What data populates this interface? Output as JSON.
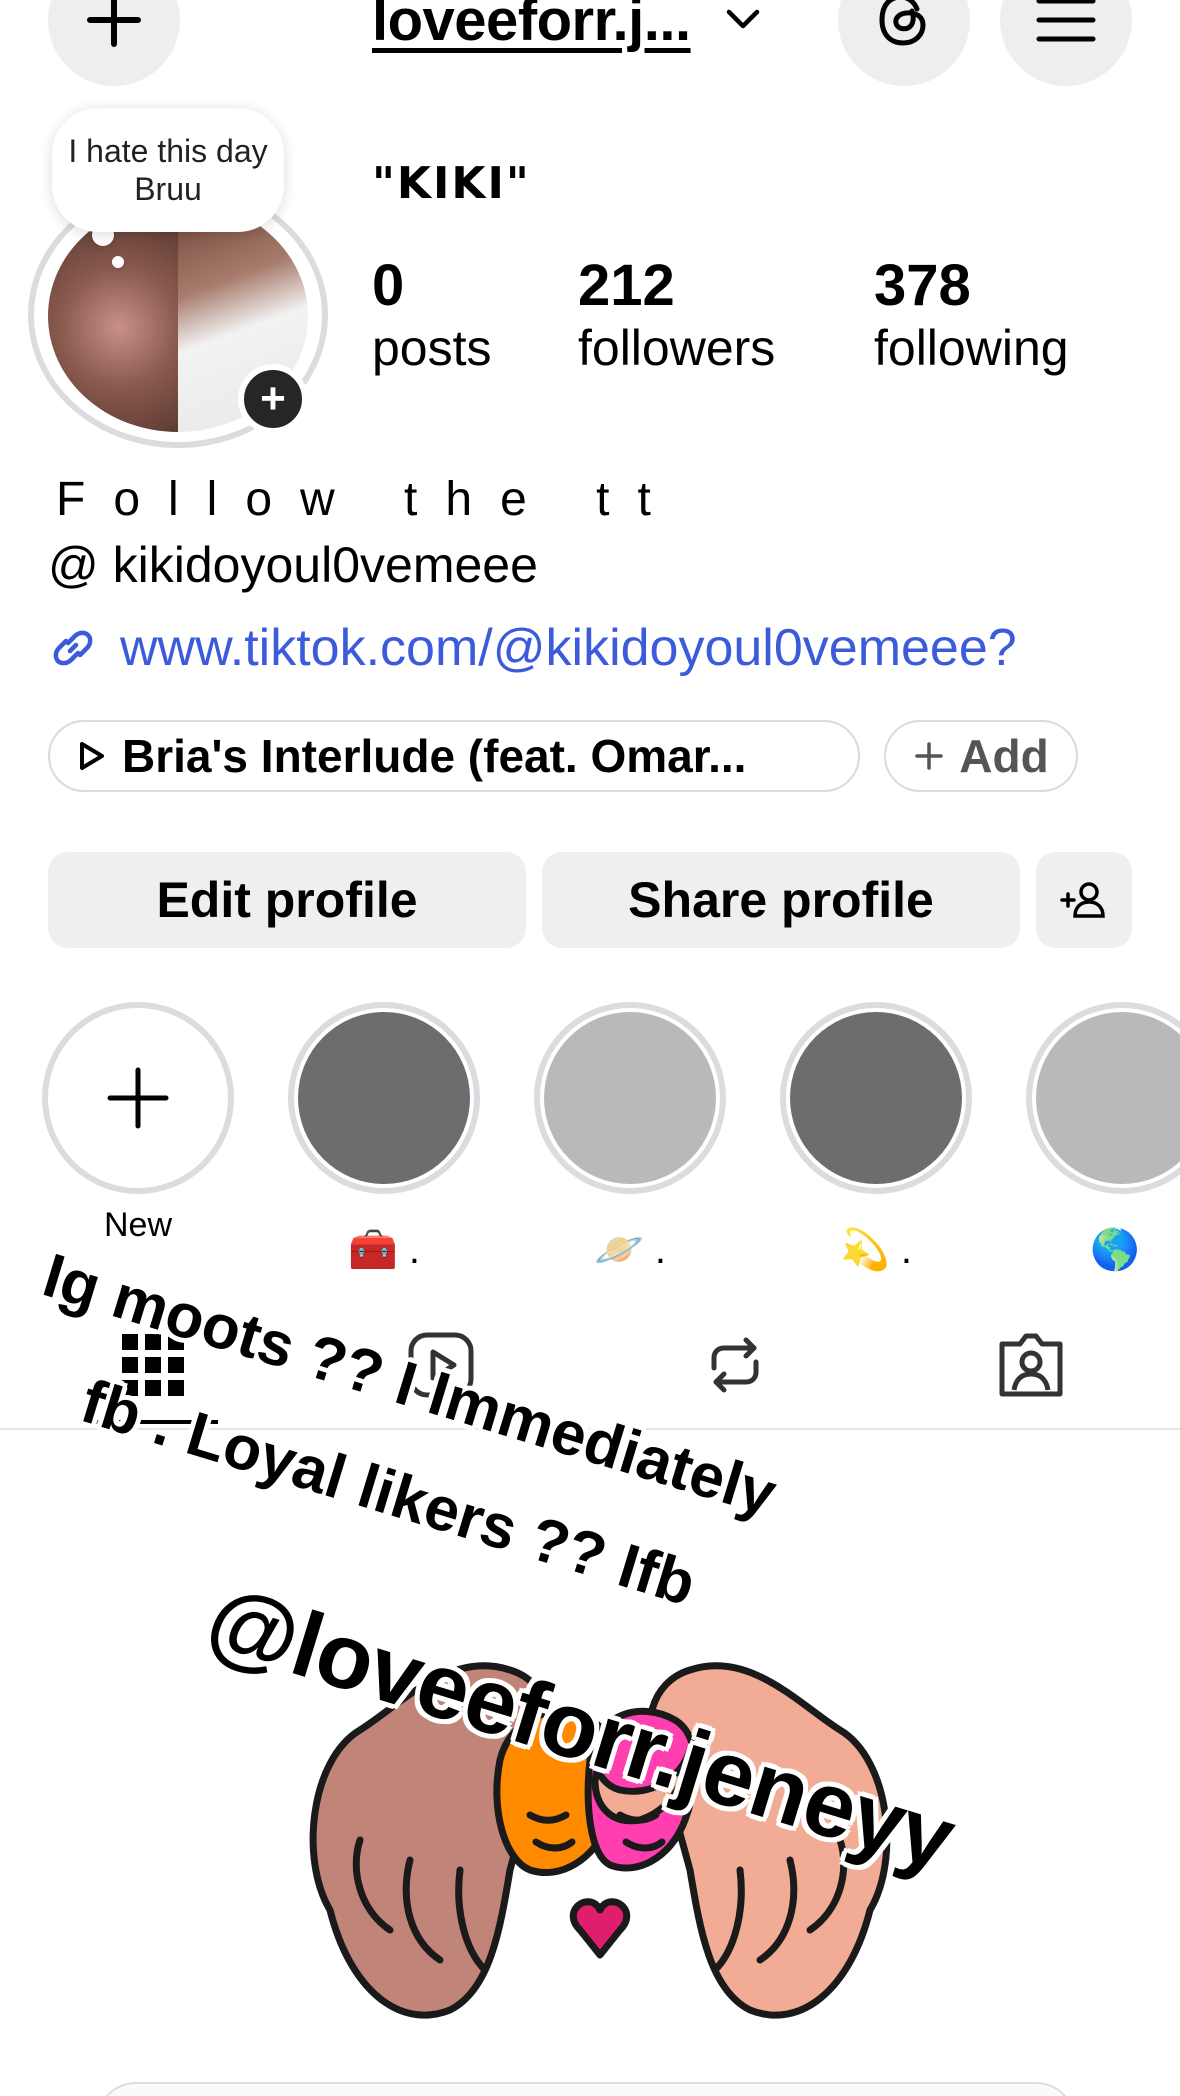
{
  "header": {
    "username": "loveeforr.j...",
    "icons": [
      "plus-icon",
      "chevron-down-icon",
      "threads-icon",
      "menu-icon"
    ]
  },
  "note": {
    "text": "I hate this day Bruu"
  },
  "profile": {
    "display_name": "\"KIKI\"",
    "stats": [
      {
        "value": "0",
        "label": "posts"
      },
      {
        "value": "212",
        "label": "followers"
      },
      {
        "value": "378",
        "label": "following"
      }
    ],
    "bio_line1": "Follow the tt",
    "bio_line2": "@ kikidoyoul0vemeee",
    "link": "www.tiktok.com/@kikidoyoul0vemeee?"
  },
  "music": {
    "song": "Bria's Interlude (feat. Omar...",
    "add_label": "Add"
  },
  "actions": {
    "edit": "Edit profile",
    "share": "Share profile"
  },
  "highlights": [
    {
      "label": "New",
      "color": "#ffffff"
    },
    {
      "label": "🧰 .",
      "color": "#6d6d70"
    },
    {
      "label": "🪐 .",
      "color": "#b9b9bb"
    },
    {
      "label": "💫 .",
      "color": "#6d6d70"
    },
    {
      "label": "🌎",
      "color": "#b9b9bb"
    }
  ],
  "tabs": [
    "grid-icon",
    "reels-icon",
    "reposts-icon",
    "tagged-icon"
  ],
  "overlay": {
    "line1": "Ig moots ?? I Immediately",
    "line2": "fb . Loyal likers ?? Ifb",
    "handle": "@loveeforr.jeneyy"
  }
}
